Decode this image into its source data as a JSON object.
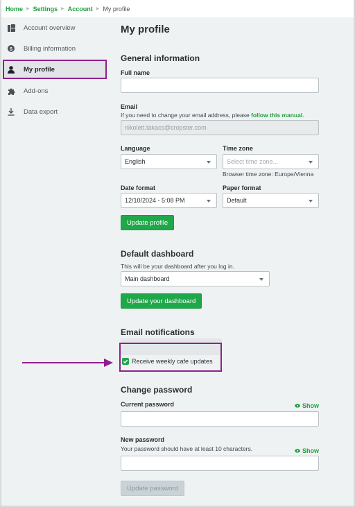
{
  "breadcrumb": {
    "items": [
      "Home",
      "Settings",
      "Account"
    ],
    "current": "My profile",
    "separator_icon": "triangle-right-icon"
  },
  "sidebar": {
    "items": [
      {
        "label": "Account overview",
        "icon": "dashboard-icon",
        "active": false
      },
      {
        "label": "Billing information",
        "icon": "dollar-circle-icon",
        "active": false
      },
      {
        "label": "My profile",
        "icon": "user-icon",
        "active": true
      },
      {
        "label": "Add-ons",
        "icon": "puzzle-icon",
        "active": false
      },
      {
        "label": "Data export",
        "icon": "download-icon",
        "active": false
      }
    ]
  },
  "page": {
    "title": "My profile"
  },
  "general": {
    "heading": "General information",
    "full_name_label": "Full name",
    "full_name_value": "",
    "email_label": "Email",
    "email_help": "If you need to change your email address, please ",
    "email_help_link": "follow this manual",
    "email_help_end": ".",
    "email_value": "nikolett.takacs@cropster.com",
    "language_label": "Language",
    "language_value": "English",
    "timezone_label": "Time zone",
    "timezone_placeholder": "Select time zone...",
    "timezone_help": "Browser time zone: Europe/Vienna",
    "date_format_label": "Date format",
    "date_format_value": "12/10/2024 - 5:08 PM",
    "paper_format_label": "Paper format",
    "paper_format_value": "Default",
    "update_button": "Update profile"
  },
  "dashboard": {
    "heading": "Default dashboard",
    "help": "This will be your dashboard after you log in.",
    "value": "Main dashboard",
    "update_button": "Update your dashboard"
  },
  "notifications": {
    "heading": "Email notifications",
    "checkbox_label": "Receive weekly cafe updates",
    "checked": true
  },
  "password": {
    "heading": "Change password",
    "current_label": "Current password",
    "show_label": "Show",
    "new_label": "New password",
    "new_help": "Your password should have at least 10 characters.",
    "update_button": "Update password"
  },
  "colors": {
    "brand_green": "#1fa84a",
    "highlight_purple": "#8e1f8e",
    "background": "#eff2f3"
  }
}
